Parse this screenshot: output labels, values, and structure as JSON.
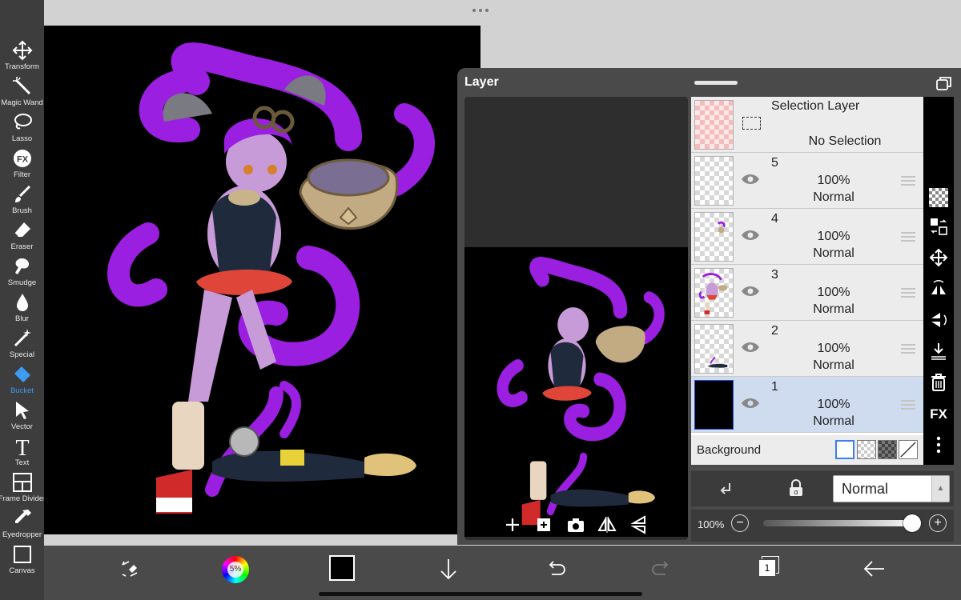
{
  "toolbar": {
    "tools": [
      {
        "label": "Transform",
        "icon": "move-icon"
      },
      {
        "label": "Magic Wand",
        "icon": "magic-wand-icon"
      },
      {
        "label": "Lasso",
        "icon": "lasso-icon"
      },
      {
        "label": "Filter",
        "icon": "fx-icon"
      },
      {
        "label": "Brush",
        "icon": "brush-icon"
      },
      {
        "label": "Eraser",
        "icon": "eraser-icon"
      },
      {
        "label": "Smudge",
        "icon": "smudge-icon"
      },
      {
        "label": "Blur",
        "icon": "blur-drop-icon"
      },
      {
        "label": "Special",
        "icon": "special-sparkle-icon"
      },
      {
        "label": "Bucket",
        "icon": "bucket-icon",
        "active": true
      },
      {
        "label": "Vector",
        "icon": "vector-arrow-icon"
      },
      {
        "label": "Text",
        "icon": "text-icon"
      },
      {
        "label": "Frame Divider",
        "icon": "frame-divider-icon"
      },
      {
        "label": "Eyedropper",
        "icon": "eyedropper-icon"
      },
      {
        "label": "Canvas",
        "icon": "canvas-icon"
      }
    ]
  },
  "layer_panel": {
    "title": "Layer",
    "selection_layer": {
      "title": "Selection Layer",
      "status": "No Selection"
    },
    "layers": [
      {
        "number": "5",
        "opacity": "100%",
        "mode": "Normal"
      },
      {
        "number": "4",
        "opacity": "100%",
        "mode": "Normal"
      },
      {
        "number": "3",
        "opacity": "100%",
        "mode": "Normal"
      },
      {
        "number": "2",
        "opacity": "100%",
        "mode": "Normal"
      },
      {
        "number": "1",
        "opacity": "100%",
        "mode": "Normal",
        "selected": true
      }
    ],
    "background_label": "Background",
    "blend_mode": "Normal",
    "opacity_label": "100%",
    "opacity_value": 1.0,
    "minus": "−",
    "plus": "+"
  },
  "bottom_bar": {
    "color_wheel_label": "5%",
    "layer_count": "1"
  },
  "colors": {
    "accent": "#3d9bf0",
    "toolbar_bg": "#3d3d3d",
    "panel_bg": "#4a4a4a",
    "selected_row": "#cfdcf0"
  }
}
